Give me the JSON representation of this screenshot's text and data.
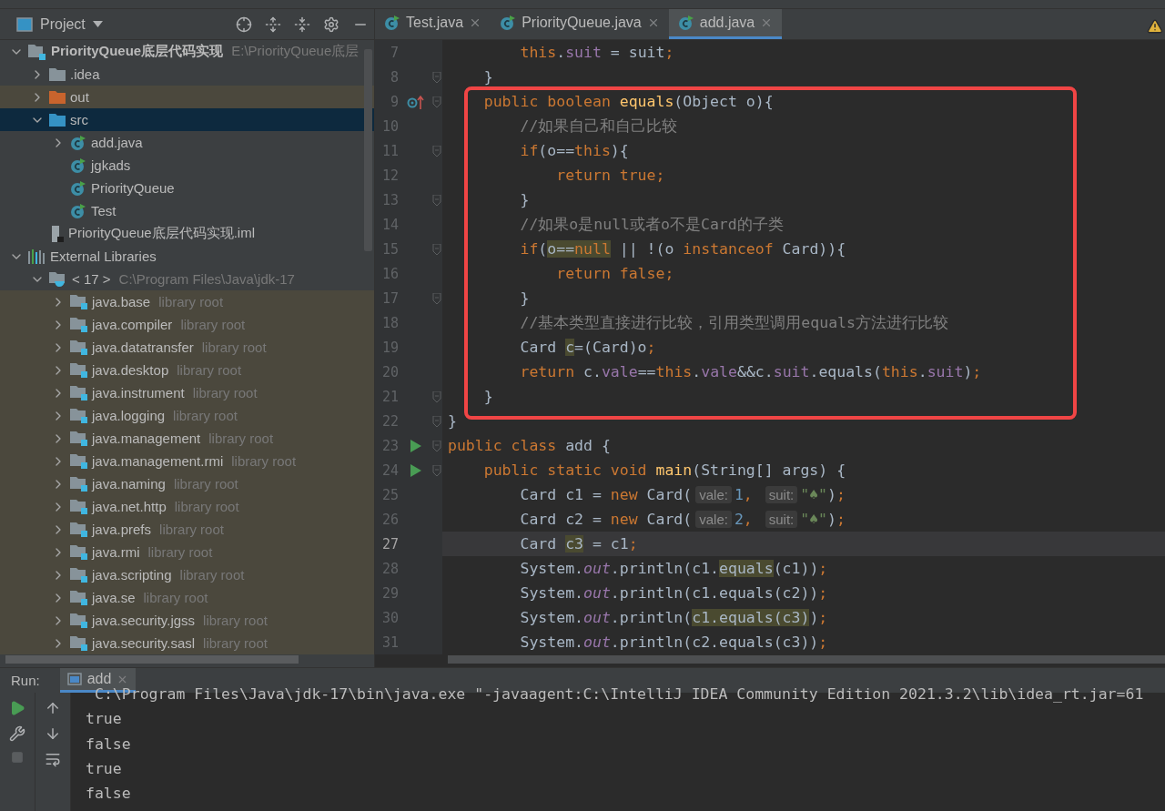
{
  "project_panel": {
    "title": "Project",
    "tree": [
      {
        "kind": "project",
        "label": "PriorityQueue底层代码实现",
        "hint": "E:\\PriorityQueue底层",
        "expanded": true,
        "selected": false,
        "highlighted": false,
        "children": [
          {
            "kind": "folder",
            "label": ".idea",
            "color": "#87939a",
            "expanded": false,
            "selected": false,
            "highlighted": false
          },
          {
            "kind": "folder",
            "label": "out",
            "color": "#c8642d",
            "expanded": false,
            "selected": false,
            "highlighted": true
          },
          {
            "kind": "folder",
            "label": "src",
            "color": "#3592c4",
            "expanded": true,
            "selected": true,
            "children": [
              {
                "kind": "class",
                "label": "add.java",
                "expanded": false,
                "selected": false,
                "highlighted": false
              },
              {
                "kind": "class",
                "label": "jgkads",
                "selected": false,
                "highlighted": false
              },
              {
                "kind": "class",
                "label": "PriorityQueue",
                "selected": false,
                "highlighted": false
              },
              {
                "kind": "class",
                "label": "Test",
                "selected": false,
                "highlighted": false
              }
            ]
          },
          {
            "kind": "file",
            "label": "PriorityQueue底层代码实现.iml",
            "selected": false,
            "highlighted": false
          }
        ]
      },
      {
        "kind": "libraries",
        "label": "External Libraries",
        "expanded": true,
        "selected": false,
        "highlighted": false,
        "children": [
          {
            "kind": "sdk",
            "label": "< 17 >",
            "hint": "C:\\Program Files\\Java\\jdk-17",
            "expanded": true,
            "selected": false,
            "highlighted": false,
            "children": [
              {
                "kind": "module",
                "label": "java.base",
                "hint": "library root",
                "expanded": false,
                "selected": false,
                "highlighted": true
              },
              {
                "kind": "module",
                "label": "java.compiler",
                "hint": "library root",
                "expanded": false,
                "selected": false,
                "highlighted": true
              },
              {
                "kind": "module",
                "label": "java.datatransfer",
                "hint": "library root",
                "expanded": false,
                "selected": false,
                "highlighted": true
              },
              {
                "kind": "module",
                "label": "java.desktop",
                "hint": "library root",
                "expanded": false,
                "selected": false,
                "highlighted": true
              },
              {
                "kind": "module",
                "label": "java.instrument",
                "hint": "library root",
                "expanded": false,
                "selected": false,
                "highlighted": true
              },
              {
                "kind": "module",
                "label": "java.logging",
                "hint": "library root",
                "expanded": false,
                "selected": false,
                "highlighted": true
              },
              {
                "kind": "module",
                "label": "java.management",
                "hint": "library root",
                "expanded": false,
                "selected": false,
                "highlighted": true
              },
              {
                "kind": "module",
                "label": "java.management.rmi",
                "hint": "library root",
                "expanded": false,
                "selected": false,
                "highlighted": true
              },
              {
                "kind": "module",
                "label": "java.naming",
                "hint": "library root",
                "expanded": false,
                "selected": false,
                "highlighted": true
              },
              {
                "kind": "module",
                "label": "java.net.http",
                "hint": "library root",
                "expanded": false,
                "selected": false,
                "highlighted": true
              },
              {
                "kind": "module",
                "label": "java.prefs",
                "hint": "library root",
                "expanded": false,
                "selected": false,
                "highlighted": true
              },
              {
                "kind": "module",
                "label": "java.rmi",
                "hint": "library root",
                "expanded": false,
                "selected": false,
                "highlighted": true
              },
              {
                "kind": "module",
                "label": "java.scripting",
                "hint": "library root",
                "expanded": false,
                "selected": false,
                "highlighted": true
              },
              {
                "kind": "module",
                "label": "java.se",
                "hint": "library root",
                "expanded": false,
                "selected": false,
                "highlighted": true
              },
              {
                "kind": "module",
                "label": "java.security.jgss",
                "hint": "library root",
                "expanded": false,
                "selected": false,
                "highlighted": true
              },
              {
                "kind": "module",
                "label": "java.security.sasl",
                "hint": "library root",
                "expanded": false,
                "selected": false,
                "highlighted": true
              }
            ]
          }
        ]
      }
    ]
  },
  "editor": {
    "tabs": [
      {
        "label": "Test.java",
        "selected": false
      },
      {
        "label": "PriorityQueue.java",
        "selected": false
      },
      {
        "label": "add.java",
        "selected": true
      }
    ],
    "lines": [
      {
        "number": "7",
        "current": false,
        "tokens": [
          {
            "t": "        this",
            "kind": "kw"
          },
          {
            "t": ".",
            "kind": "plain"
          },
          {
            "t": "suit",
            "kind": "field"
          },
          {
            "t": " = suit",
            "kind": "plain"
          },
          {
            "t": ";",
            "kind": "kw"
          }
        ]
      },
      {
        "number": "8",
        "current": false,
        "fold": true,
        "tokens": [
          {
            "t": "    }",
            "kind": "plain"
          }
        ]
      },
      {
        "number": "9",
        "current": false,
        "gutter": {
          "kind": "override"
        },
        "fold": true,
        "tokens": [
          {
            "t": "    public boolean ",
            "kind": "kw"
          },
          {
            "t": "equals",
            "kind": "method"
          },
          {
            "t": "(Object o){",
            "kind": "plain"
          }
        ]
      },
      {
        "number": "10",
        "current": false,
        "tokens": [
          {
            "t": "        //如果自己和自己比较",
            "kind": "comment"
          }
        ]
      },
      {
        "number": "11",
        "current": false,
        "fold": true,
        "tokens": [
          {
            "t": "        if",
            "kind": "kw"
          },
          {
            "t": "(o==",
            "kind": "plain"
          },
          {
            "t": "this",
            "kind": "kw"
          },
          {
            "t": "){",
            "kind": "plain"
          }
        ]
      },
      {
        "number": "12",
        "current": false,
        "tokens": [
          {
            "t": "            return true;",
            "kind": "kw"
          }
        ]
      },
      {
        "number": "13",
        "current": false,
        "fold": true,
        "tokens": [
          {
            "t": "        }",
            "kind": "plain"
          }
        ]
      },
      {
        "number": "14",
        "current": false,
        "tokens": [
          {
            "t": "        //如果o是null或者o不是Card的子类",
            "kind": "comment"
          }
        ]
      },
      {
        "number": "15",
        "current": false,
        "fold": true,
        "tokens": [
          {
            "t": "        if",
            "kind": "kw"
          },
          {
            "t": "(",
            "kind": "plain"
          },
          {
            "t": "o==",
            "kind": "plain",
            "match": true
          },
          {
            "t": "null",
            "kind": "kw",
            "match": true
          },
          {
            "t": " || !(o ",
            "kind": "plain"
          },
          {
            "t": "instanceof",
            "kind": "kw"
          },
          {
            "t": " Card)){",
            "kind": "plain"
          }
        ]
      },
      {
        "number": "16",
        "current": false,
        "tokens": [
          {
            "t": "            return false;",
            "kind": "kw"
          }
        ]
      },
      {
        "number": "17",
        "current": false,
        "fold": true,
        "tokens": [
          {
            "t": "        }",
            "kind": "plain"
          }
        ]
      },
      {
        "number": "18",
        "current": false,
        "tokens": [
          {
            "t": "        //基本类型直接进行比较，引用类型调用equals方法进行比较",
            "kind": "comment"
          }
        ]
      },
      {
        "number": "19",
        "current": false,
        "tokens": [
          {
            "t": "        Card ",
            "kind": "plain"
          },
          {
            "t": "c",
            "kind": "plain",
            "match": true
          },
          {
            "t": "=(Card)o",
            "kind": "plain"
          },
          {
            "t": ";",
            "kind": "kw"
          }
        ]
      },
      {
        "number": "20",
        "current": false,
        "tokens": [
          {
            "t": "        return ",
            "kind": "kw"
          },
          {
            "t": "c.",
            "kind": "plain"
          },
          {
            "t": "vale",
            "kind": "field"
          },
          {
            "t": "==",
            "kind": "plain"
          },
          {
            "t": "this",
            "kind": "kw"
          },
          {
            "t": ".",
            "kind": "plain"
          },
          {
            "t": "vale",
            "kind": "field"
          },
          {
            "t": "&&c.",
            "kind": "plain"
          },
          {
            "t": "suit",
            "kind": "field"
          },
          {
            "t": ".equals(",
            "kind": "plain"
          },
          {
            "t": "this",
            "kind": "kw"
          },
          {
            "t": ".",
            "kind": "plain"
          },
          {
            "t": "suit",
            "kind": "field"
          },
          {
            "t": ")",
            "kind": "plain"
          },
          {
            "t": ";",
            "kind": "kw"
          }
        ]
      },
      {
        "number": "21",
        "current": false,
        "fold": true,
        "tokens": [
          {
            "t": "    }",
            "kind": "plain"
          }
        ]
      },
      {
        "number": "22",
        "current": false,
        "fold": true,
        "tokens": [
          {
            "t": "}",
            "kind": "plain"
          }
        ]
      },
      {
        "number": "23",
        "current": false,
        "gutter": {
          "kind": "run"
        },
        "fold": true,
        "tokens": [
          {
            "t": "public class ",
            "kind": "kw"
          },
          {
            "t": "add {",
            "kind": "plain"
          }
        ]
      },
      {
        "number": "24",
        "current": false,
        "gutter": {
          "kind": "run"
        },
        "fold": true,
        "tokens": [
          {
            "t": "    public static void ",
            "kind": "kw"
          },
          {
            "t": "main",
            "kind": "method"
          },
          {
            "t": "(String[] args) {",
            "kind": "plain"
          }
        ]
      },
      {
        "number": "25",
        "current": false,
        "tokens": [
          {
            "t": "        Card c1 = ",
            "kind": "plain"
          },
          {
            "t": "new ",
            "kind": "kw"
          },
          {
            "t": "Card(",
            "kind": "plain"
          },
          {
            "t": "vale:",
            "kind": "hint"
          },
          {
            "t": "1",
            "kind": "num"
          },
          {
            "t": ", ",
            "kind": "kw"
          },
          {
            "t": "suit:",
            "kind": "hint"
          },
          {
            "t": "\"♠\"",
            "kind": "str"
          },
          {
            "t": ")",
            "kind": "plain"
          },
          {
            "t": ";",
            "kind": "kw"
          }
        ]
      },
      {
        "number": "26",
        "current": false,
        "tokens": [
          {
            "t": "        Card c2 = ",
            "kind": "plain"
          },
          {
            "t": "new ",
            "kind": "kw"
          },
          {
            "t": "Card(",
            "kind": "plain"
          },
          {
            "t": "vale:",
            "kind": "hint"
          },
          {
            "t": "2",
            "kind": "num"
          },
          {
            "t": ", ",
            "kind": "kw"
          },
          {
            "t": "suit:",
            "kind": "hint"
          },
          {
            "t": "\"♠\"",
            "kind": "str"
          },
          {
            "t": ")",
            "kind": "plain"
          },
          {
            "t": ";",
            "kind": "kw"
          }
        ]
      },
      {
        "number": "27",
        "current": true,
        "tokens": [
          {
            "t": "        Card ",
            "kind": "plain"
          },
          {
            "t": "c3",
            "kind": "plain",
            "match": true
          },
          {
            "t": " = c1",
            "kind": "plain"
          },
          {
            "t": ";",
            "kind": "kw"
          }
        ]
      },
      {
        "number": "28",
        "current": false,
        "tokens": [
          {
            "t": "        System.",
            "kind": "plain"
          },
          {
            "t": "out",
            "kind": "static"
          },
          {
            "t": ".println(c1.",
            "kind": "plain"
          },
          {
            "t": "equals",
            "kind": "plain",
            "match": true
          },
          {
            "t": "(c1))",
            "kind": "plain"
          },
          {
            "t": ";",
            "kind": "kw"
          }
        ]
      },
      {
        "number": "29",
        "current": false,
        "tokens": [
          {
            "t": "        System.",
            "kind": "plain"
          },
          {
            "t": "out",
            "kind": "static"
          },
          {
            "t": ".println(c1.equals(c2))",
            "kind": "plain"
          },
          {
            "t": ";",
            "kind": "kw"
          }
        ]
      },
      {
        "number": "30",
        "current": false,
        "tokens": [
          {
            "t": "        System.",
            "kind": "plain"
          },
          {
            "t": "out",
            "kind": "static"
          },
          {
            "t": ".println(",
            "kind": "plain"
          },
          {
            "t": "c1.equals(c3)",
            "kind": "plain",
            "match": true
          },
          {
            "t": ")",
            "kind": "plain"
          },
          {
            "t": ";",
            "kind": "kw"
          }
        ]
      },
      {
        "number": "31",
        "current": false,
        "tokens": [
          {
            "t": "        System.",
            "kind": "plain"
          },
          {
            "t": "out",
            "kind": "static"
          },
          {
            "t": ".println(c2.equals(c3))",
            "kind": "plain"
          },
          {
            "t": ";",
            "kind": "kw"
          }
        ]
      }
    ]
  },
  "run_panel": {
    "label": "Run:",
    "tabs": [
      {
        "label": "add",
        "selected": true
      }
    ],
    "console": [
      "C:\\Program Files\\Java\\jdk-17\\bin\\java.exe \"-javaagent:C:\\IntelliJ IDEA Community Edition 2021.3.2\\lib\\idea_rt.jar=61",
      "true",
      "false",
      "true",
      "false"
    ]
  }
}
